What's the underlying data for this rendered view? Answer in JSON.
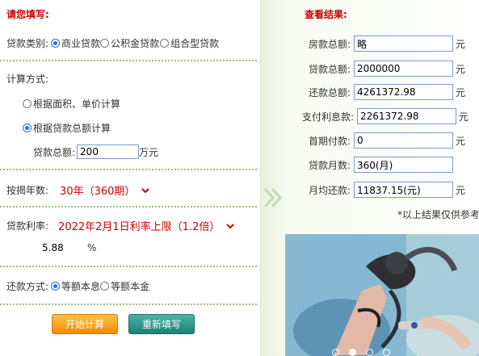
{
  "form": {
    "heading": "请您填写:",
    "loan_type": {
      "label": "贷款类别:",
      "options": [
        "商业贷款",
        "公积金贷款",
        "组合型贷款"
      ],
      "selected": "商业贷款"
    },
    "calc_method": {
      "label": "计算方式:",
      "options": [
        "根据面积、单价计算",
        "根据贷款总额计算"
      ],
      "selected": "根据贷款总额计算"
    },
    "loan_total": {
      "label": "贷款总额:",
      "value": "200",
      "unit": "万元"
    },
    "years": {
      "label": "按揭年数:",
      "value": "30年（360期）"
    },
    "rate": {
      "label": "贷款利率:",
      "value": "2022年2月1日利率上限（1.2倍）",
      "number": "5.88",
      "unit": "%"
    },
    "repay_method": {
      "label": "还款方式:",
      "options": [
        "等额本息",
        "等额本金"
      ],
      "selected": "等额本息"
    },
    "buttons": {
      "calculate": "开始计算",
      "reset": "重新填写"
    }
  },
  "results": {
    "heading": "查看结果:",
    "rows": [
      {
        "label": "房款总额:",
        "value": "略",
        "unit": "元"
      },
      {
        "label": "贷款总额:",
        "value": "2000000",
        "unit": "元"
      },
      {
        "label": "还款总额:",
        "value": "4261372.98",
        "unit": "元"
      },
      {
        "label": "支付利息款:",
        "value": "2261372.98",
        "unit": "元"
      },
      {
        "label": "首期付款:",
        "value": "0",
        "unit": "元"
      },
      {
        "label": "贷款月数:",
        "value": "360(月)",
        "unit": ""
      },
      {
        "label": "月均还款:",
        "value": "11837.15(元)",
        "unit": "元"
      }
    ],
    "note": "*以上结果仅供参考"
  },
  "icons": {
    "arrow": "double-chevron-right-icon",
    "select": "chevron-down-icon"
  },
  "colors": {
    "accent_red": "#cc0000",
    "radio_blue": "#1a73e8",
    "dotted_green": "#9cc07a"
  }
}
